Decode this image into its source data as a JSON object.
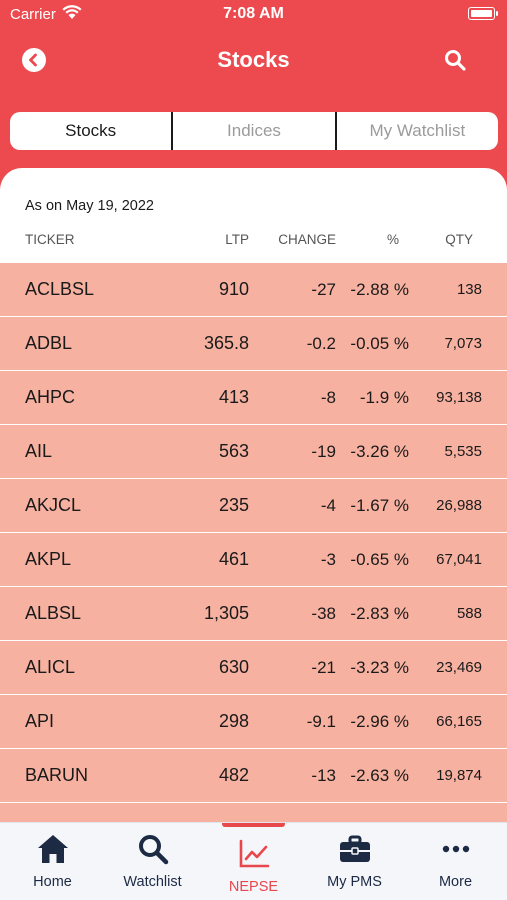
{
  "status_bar": {
    "carrier": "Carrier",
    "time": "7:08 AM"
  },
  "header": {
    "title": "Stocks",
    "back_icon": "back-icon",
    "search_icon": "search-icon",
    "background": "#ec4a4f"
  },
  "tabs": [
    {
      "label": "Stocks",
      "active": true
    },
    {
      "label": "Indices",
      "active": false
    },
    {
      "label": "My Watchlist",
      "active": false
    }
  ],
  "table": {
    "as_on": "As on May 19, 2022",
    "headers": {
      "ticker": "TICKER",
      "ltp": "LTP",
      "change": "CHANGE",
      "pct": "%",
      "qty": "QTY"
    },
    "row_color": "#f7b1a1",
    "rows": [
      {
        "ticker": "ACLBSL",
        "ltp": "910",
        "change": "-27",
        "pct": "-2.88 %",
        "qty": "138"
      },
      {
        "ticker": "ADBL",
        "ltp": "365.8",
        "change": "-0.2",
        "pct": "-0.05 %",
        "qty": "7,073"
      },
      {
        "ticker": "AHPC",
        "ltp": "413",
        "change": "-8",
        "pct": "-1.9 %",
        "qty": "93,138"
      },
      {
        "ticker": "AIL",
        "ltp": "563",
        "change": "-19",
        "pct": "-3.26 %",
        "qty": "5,535"
      },
      {
        "ticker": "AKJCL",
        "ltp": "235",
        "change": "-4",
        "pct": "-1.67 %",
        "qty": "26,988"
      },
      {
        "ticker": "AKPL",
        "ltp": "461",
        "change": "-3",
        "pct": "-0.65 %",
        "qty": "67,041"
      },
      {
        "ticker": "ALBSL",
        "ltp": "1,305",
        "change": "-38",
        "pct": "-2.83 %",
        "qty": "588"
      },
      {
        "ticker": "ALICL",
        "ltp": "630",
        "change": "-21",
        "pct": "-3.23 %",
        "qty": "23,469"
      },
      {
        "ticker": "API",
        "ltp": "298",
        "change": "-9.1",
        "pct": "-2.96 %",
        "qty": "66,165"
      },
      {
        "ticker": "BARUN",
        "ltp": "482",
        "change": "-13",
        "pct": "-2.63 %",
        "qty": "19,874"
      }
    ]
  },
  "bottom_nav": {
    "accent": "#e8474c",
    "items": [
      {
        "label": "Home",
        "icon": "home-icon",
        "active": false
      },
      {
        "label": "Watchlist",
        "icon": "search-icon",
        "active": false
      },
      {
        "label": "NEPSE",
        "icon": "chart-line-icon",
        "active": true
      },
      {
        "label": "My PMS",
        "icon": "briefcase-icon",
        "active": false
      },
      {
        "label": "More",
        "icon": "more-dots-icon",
        "active": false
      }
    ]
  }
}
